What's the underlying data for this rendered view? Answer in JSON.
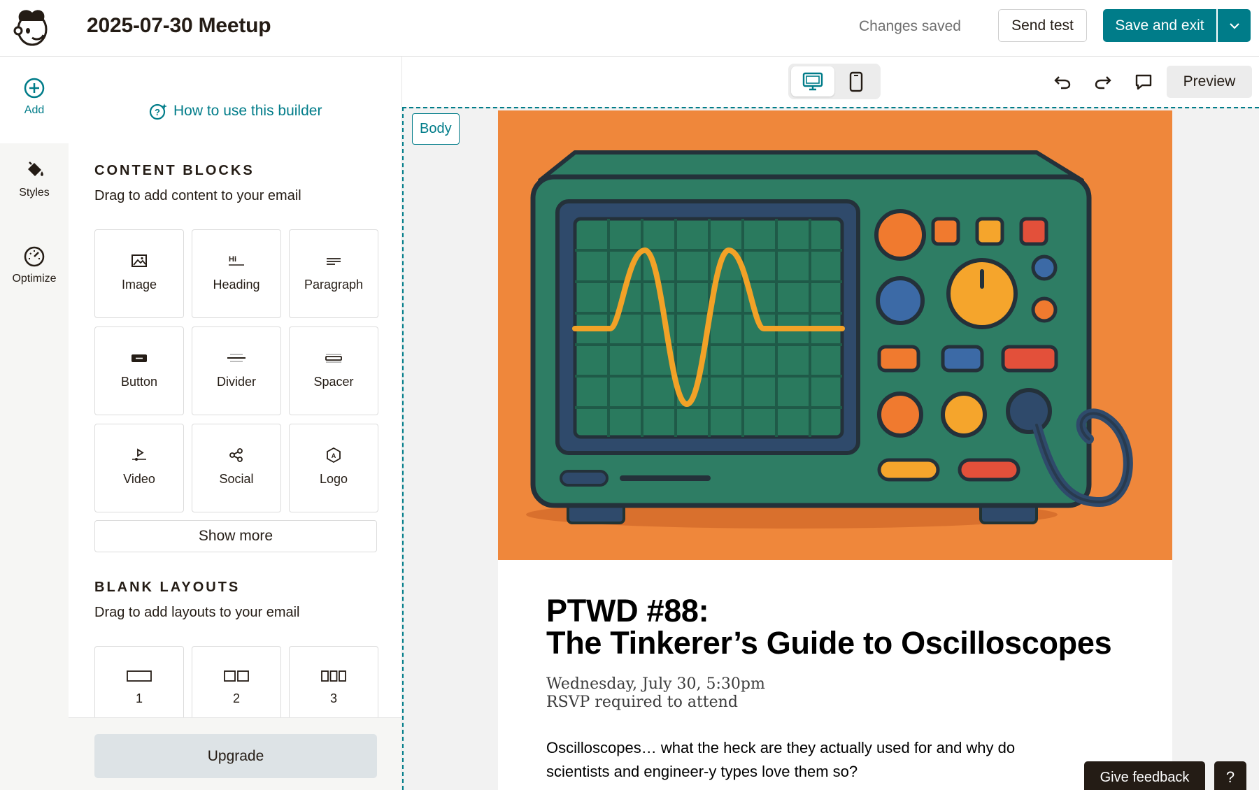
{
  "header": {
    "title": "2025-07-30 Meetup",
    "status": "Changes saved",
    "send_test_label": "Send test",
    "save_exit_label": "Save and exit"
  },
  "rail": {
    "items": [
      {
        "label": "Add",
        "icon": "plus-circle-icon"
      },
      {
        "label": "Styles",
        "icon": "paint-bucket-icon"
      },
      {
        "label": "Optimize",
        "icon": "gauge-icon"
      }
    ]
  },
  "panel": {
    "howto_label": "How to use this builder",
    "content_blocks": {
      "title": "CONTENT BLOCKS",
      "subtitle": "Drag to add content to your email",
      "items": [
        {
          "label": "Image",
          "icon": "image-icon"
        },
        {
          "label": "Heading",
          "icon": "heading-icon"
        },
        {
          "label": "Paragraph",
          "icon": "paragraph-icon"
        },
        {
          "label": "Button",
          "icon": "button-icon"
        },
        {
          "label": "Divider",
          "icon": "divider-icon"
        },
        {
          "label": "Spacer",
          "icon": "spacer-icon"
        },
        {
          "label": "Video",
          "icon": "video-icon"
        },
        {
          "label": "Social",
          "icon": "share-icon"
        },
        {
          "label": "Logo",
          "icon": "logo-icon"
        }
      ],
      "show_more_label": "Show more"
    },
    "blank_layouts": {
      "title": "BLANK LAYOUTS",
      "subtitle": "Drag to add layouts to your email",
      "items": [
        {
          "label": "1"
        },
        {
          "label": "2"
        },
        {
          "label": "3"
        }
      ]
    },
    "upgrade_label": "Upgrade"
  },
  "toolbar": {
    "preview_label": "Preview",
    "body_tag": "Body"
  },
  "email": {
    "title_line1": "PTWD #88:",
    "title_line2": "The Tinkerer’s Guide to Oscilloscopes",
    "date_line": "Wednesday, July 30, 5:30pm",
    "rsvp_line": "RSVP required to attend",
    "intro": "Oscilloscopes… what the heck are they actually used for and why do scientists and engineer-y types love them so?"
  },
  "footer": {
    "feedback_label": "Give feedback",
    "help_label": "?"
  },
  "colors": {
    "brand": "#007c89",
    "hero_bg": "#ef873b",
    "scope_body": "#2e7d64",
    "dark": "#241c15"
  }
}
